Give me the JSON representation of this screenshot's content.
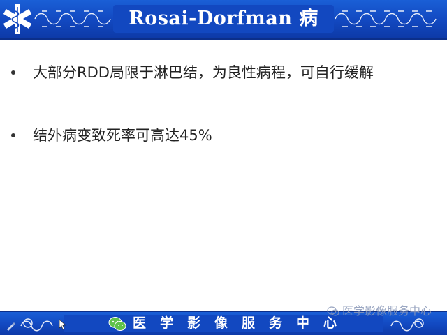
{
  "slide": {
    "title": "Rosai-Dorfman 病",
    "bullets": [
      {
        "text": "大部分RDD局限于淋巴结，为良性病程，可自行缓解"
      },
      {
        "text": "结外病变致死率可高达45%"
      }
    ],
    "footer_title": "医学影像服务中心",
    "watermark": "医学影像服务中心"
  },
  "icons": {
    "header_logo": "star-of-life-icon",
    "footer_app": "wechat-icon",
    "watermark_icon": "wechat-icon",
    "pen": "pen-icon",
    "cursor": "cursor-icon"
  },
  "colors": {
    "band_blue": "#1248c0",
    "band_dark": "#0b2f8a",
    "title_text": "#ffffff",
    "body_text": "#222222",
    "watermark": "#8a98b8"
  }
}
